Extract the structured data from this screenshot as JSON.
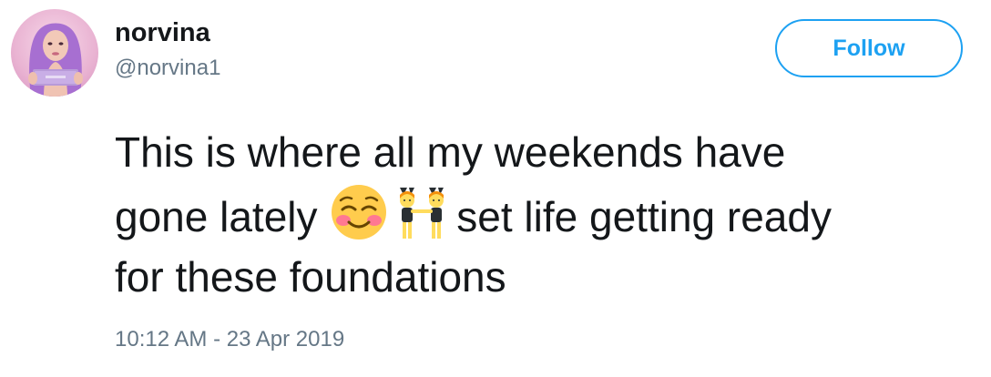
{
  "tweet": {
    "author": {
      "display_name": "norvina",
      "handle": "@norvina1",
      "avatar_icon": "profile-photo"
    },
    "follow_button_label": "Follow",
    "text": {
      "line1": "This is where all my weekends have",
      "line2_start": "gone lately",
      "emoji1": "smiling-face-with-blush",
      "emoji2": "people-with-bunny-ears",
      "line2_end": "set life getting ready",
      "line3": "for these foundations"
    },
    "timestamp": "10:12 AM - 23 Apr 2019"
  },
  "colors": {
    "accent": "#1da1f2",
    "text": "#14171a",
    "secondary_text": "#657786"
  }
}
